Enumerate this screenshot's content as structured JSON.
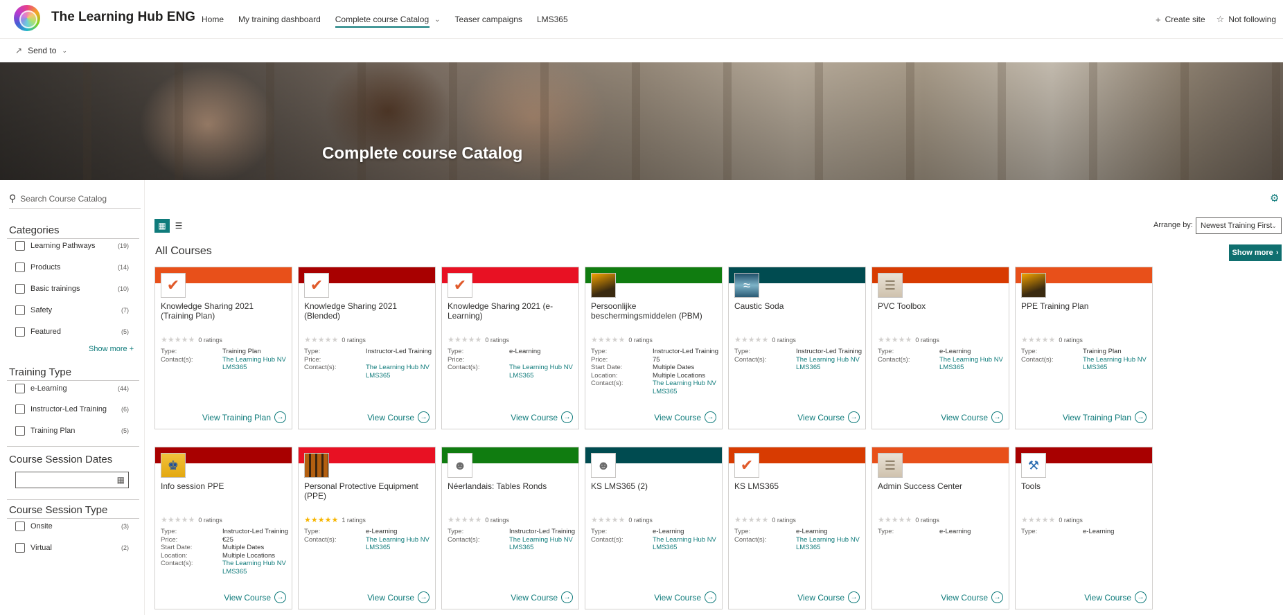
{
  "site": {
    "title": "The Learning Hub ENG",
    "nav": [
      {
        "label": "Home"
      },
      {
        "label": "My training dashboard"
      },
      {
        "label": "Complete course Catalog",
        "active": true,
        "has_dropdown": true
      },
      {
        "label": "Teaser campaigns"
      },
      {
        "label": "LMS365"
      }
    ],
    "create_site": "Create site",
    "not_following": "Not following"
  },
  "command_bar": {
    "send_to": "Send to"
  },
  "hero": {
    "title": "Complete course Catalog"
  },
  "sidebar": {
    "search_placeholder": "Search Course Catalog",
    "categories": {
      "title": "Categories",
      "items": [
        {
          "label": "Learning Pathways",
          "count": "(19)"
        },
        {
          "label": "Products",
          "count": "(14)"
        },
        {
          "label": "Basic trainings",
          "count": "(10)"
        },
        {
          "label": "Safety",
          "count": "(7)"
        },
        {
          "label": "Featured",
          "count": "(5)"
        }
      ],
      "show_more": "Show more +"
    },
    "training_type": {
      "title": "Training Type",
      "items": [
        {
          "label": "e-Learning",
          "count": "(44)"
        },
        {
          "label": "Instructor-Led Training",
          "count": "(6)"
        },
        {
          "label": "Training Plan",
          "count": "(5)"
        }
      ]
    },
    "session_dates": {
      "title": "Course Session Dates"
    },
    "session_type": {
      "title": "Course Session Type",
      "items": [
        {
          "label": "Onsite",
          "count": "(3)"
        },
        {
          "label": "Virtual",
          "count": "(2)"
        }
      ]
    }
  },
  "main": {
    "arrange_label": "Arrange by:",
    "arrange_value": "Newest Training First",
    "section_title": "All Courses",
    "show_more": "Show more"
  },
  "colors": {
    "accent": "#0f7b7b",
    "orange": "#e8501a",
    "darkred": "#a80000",
    "red": "#e81123",
    "green": "#107c10",
    "teal": "#004b50",
    "orangered": "#d83b01"
  },
  "courses": [
    {
      "title": "Knowledge Sharing 2021 (Training Plan)",
      "color": "#e8501a",
      "thumb": "check",
      "stars": 0,
      "ratings": "0 ratings",
      "props": [
        [
          "Type:",
          "Training Plan"
        ],
        [
          "Contact(s):",
          "The Learning Hub NV",
          true
        ],
        [
          "",
          "LMS365",
          true
        ]
      ],
      "link": "View Training Plan"
    },
    {
      "title": "Knowledge Sharing 2021 (Blended)",
      "color": "#a80000",
      "thumb": "check",
      "stars": 0,
      "ratings": "0 ratings",
      "props": [
        [
          "Type:",
          "Instructor-Led Training"
        ],
        [
          "Price:",
          ""
        ],
        [
          "Contact(s):",
          "The Learning Hub NV",
          true
        ],
        [
          "",
          "LMS365",
          true
        ]
      ],
      "link": "View Course"
    },
    {
      "title": "Knowledge Sharing 2021 (e-Learning)",
      "color": "#e81123",
      "thumb": "check",
      "stars": 0,
      "ratings": "0 ratings",
      "props": [
        [
          "Type:",
          "e-Learning"
        ],
        [
          "Price:",
          ""
        ],
        [
          "Contact(s):",
          "The Learning Hub NV",
          true
        ],
        [
          "",
          "LMS365",
          true
        ]
      ],
      "link": "View Course"
    },
    {
      "title": "Persoonlijke beschermingsmiddelen (PBM)",
      "color": "#107c10",
      "thumb": "photo-a",
      "stars": 0,
      "ratings": "0 ratings",
      "props": [
        [
          "Type:",
          "Instructor-Led Training"
        ],
        [
          "Price:",
          "75"
        ],
        [
          "Start Date:",
          "Multiple Dates"
        ],
        [
          "Location:",
          "Multiple Locations"
        ],
        [
          "Contact(s):",
          "The Learning Hub NV",
          true
        ],
        [
          "",
          "LMS365",
          true
        ]
      ],
      "link": "View Course"
    },
    {
      "title": "Caustic Soda",
      "color": "#004b50",
      "thumb": "photo-b",
      "stars": 0,
      "ratings": "0 ratings",
      "props": [
        [
          "Type:",
          "Instructor-Led Training"
        ],
        [
          "Contact(s):",
          "The Learning Hub NV",
          true
        ],
        [
          "",
          "LMS365",
          true
        ]
      ],
      "link": "View Course"
    },
    {
      "title": "PVC Toolbox",
      "color": "#d83b01",
      "thumb": "photo-c",
      "stars": 0,
      "ratings": "0 ratings",
      "props": [
        [
          "Type:",
          "e-Learning"
        ],
        [
          "Contact(s):",
          "The Learning Hub NV",
          true
        ],
        [
          "",
          "LMS365",
          true
        ]
      ],
      "link": "View Course"
    },
    {
      "title": "PPE Training Plan",
      "color": "#e8501a",
      "thumb": "photo-a",
      "stars": 0,
      "ratings": "0 ratings",
      "props": [
        [
          "Type:",
          "Training Plan"
        ],
        [
          "Contact(s):",
          "The Learning Hub NV",
          true
        ],
        [
          "",
          "LMS365",
          true
        ]
      ],
      "link": "View Training Plan"
    },
    {
      "title": "Info session PPE",
      "color": "#a80000",
      "thumb": "photo-d",
      "stars": 0,
      "ratings": "0 ratings",
      "props": [
        [
          "Type:",
          "Instructor-Led Training"
        ],
        [
          "Price:",
          "€25"
        ],
        [
          "Start Date:",
          "Multiple Dates"
        ],
        [
          "Location:",
          "Multiple Locations"
        ],
        [
          "Contact(s):",
          "The Learning Hub NV",
          true
        ],
        [
          "",
          "LMS365",
          true
        ]
      ],
      "link": "View Course"
    },
    {
      "title": "Personal Protective Equipment (PPE)",
      "color": "#e81123",
      "thumb": "photo-e",
      "stars": 5,
      "ratings": "1 ratings",
      "props": [
        [
          "Type:",
          "e-Learning"
        ],
        [
          "Contact(s):",
          "The Learning Hub NV",
          true
        ],
        [
          "",
          "LMS365",
          true
        ]
      ],
      "link": "View Course"
    },
    {
      "title": "Néerlandais: Tables Ronds",
      "color": "#107c10",
      "thumb": "head",
      "stars": 0,
      "ratings": "0 ratings",
      "props": [
        [
          "Type:",
          "Instructor-Led Training"
        ],
        [
          "Contact(s):",
          "The Learning Hub NV",
          true
        ],
        [
          "",
          "LMS365",
          true
        ]
      ],
      "link": "View Course"
    },
    {
      "title": "KS LMS365 (2)",
      "color": "#004b50",
      "thumb": "head",
      "stars": 0,
      "ratings": "0 ratings",
      "props": [
        [
          "Type:",
          "e-Learning"
        ],
        [
          "Contact(s):",
          "The Learning Hub NV",
          true
        ],
        [
          "",
          "LMS365",
          true
        ]
      ],
      "link": "View Course"
    },
    {
      "title": "KS LMS365",
      "color": "#d83b01",
      "thumb": "check",
      "stars": 0,
      "ratings": "0 ratings",
      "props": [
        [
          "Type:",
          "e-Learning"
        ],
        [
          "Contact(s):",
          "The Learning Hub NV",
          true
        ],
        [
          "",
          "LMS365",
          true
        ]
      ],
      "link": "View Course"
    },
    {
      "title": "Admin Success Center",
      "color": "#e8501a",
      "thumb": "photo-c",
      "stars": 0,
      "ratings": "0 ratings",
      "props": [
        [
          "Type:",
          "e-Learning"
        ]
      ],
      "link": "View Course"
    },
    {
      "title": "Tools",
      "color": "#a80000",
      "thumb": "tool",
      "stars": 0,
      "ratings": "0 ratings",
      "props": [
        [
          "Type:",
          "e-Learning"
        ]
      ],
      "link": "View Course"
    }
  ]
}
